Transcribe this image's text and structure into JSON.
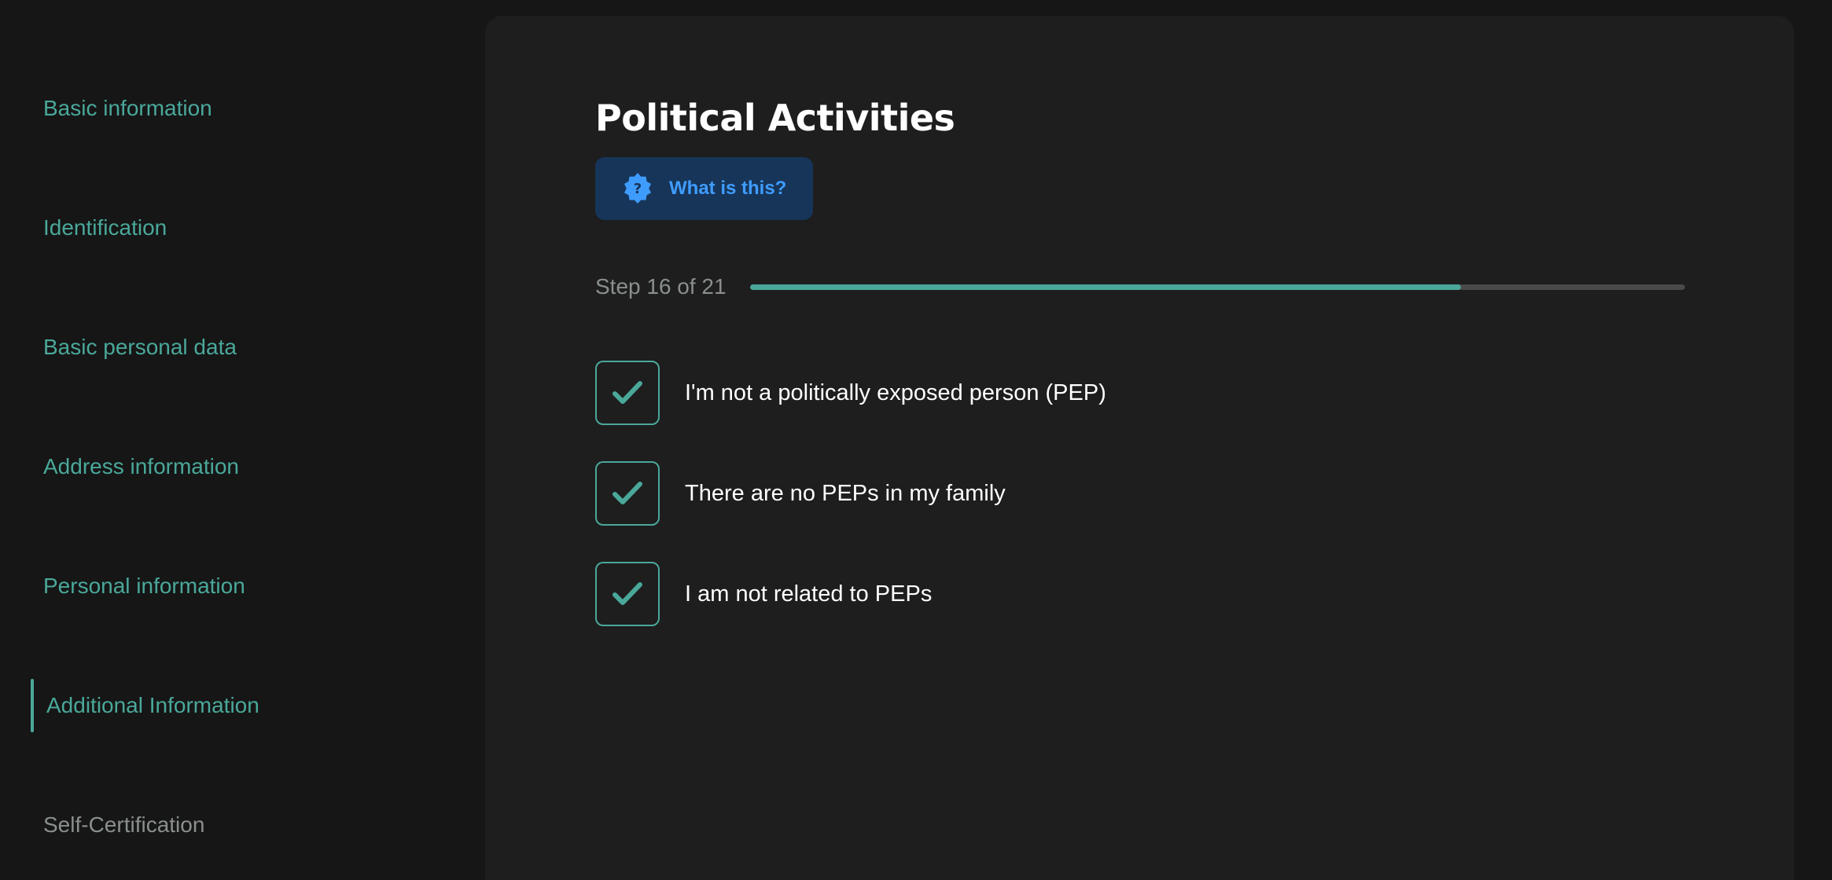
{
  "sidebar": {
    "items": [
      {
        "label": "Basic information",
        "state": "completed"
      },
      {
        "label": "Identification",
        "state": "completed"
      },
      {
        "label": "Basic personal data",
        "state": "completed"
      },
      {
        "label": "Address information",
        "state": "completed"
      },
      {
        "label": "Personal information",
        "state": "completed"
      },
      {
        "label": "Additional Information",
        "state": "active"
      },
      {
        "label": "Self-Certification",
        "state": "pending"
      }
    ]
  },
  "main": {
    "title": "Political Activities",
    "help_button": {
      "label": "What is this?",
      "icon": "question-badge-icon"
    },
    "progress": {
      "text": "Step 16 of 21",
      "current": 16,
      "total": 21,
      "fill_fraction": 0.76
    },
    "checkboxes": [
      {
        "label": "I'm not a politically exposed person (PEP)",
        "checked": true
      },
      {
        "label": "There are no PEPs in my family",
        "checked": true
      },
      {
        "label": "I am not related to PEPs",
        "checked": true
      }
    ]
  },
  "colors": {
    "accent": "#4aa89a",
    "background": "#161616",
    "card": "#1e1e1e",
    "help_bg": "#173559",
    "help_text": "#3f9cff",
    "muted": "#8a8f8e",
    "track": "#4a4a4a"
  }
}
